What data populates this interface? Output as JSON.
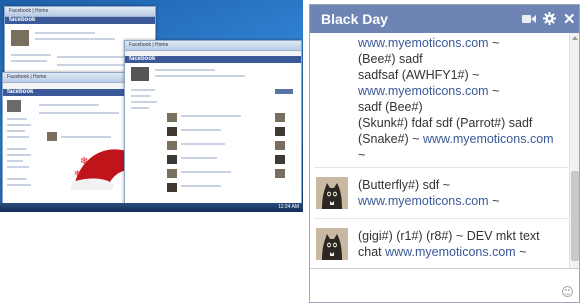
{
  "desktop": {
    "facebook_logo": "facebook",
    "windows": [
      {
        "caption": "Facebook | Home"
      },
      {
        "caption": "Facebook | Home"
      },
      {
        "caption": "Facebook | Home"
      }
    ],
    "clock": "11:24 AM"
  },
  "chat": {
    "title": "Black Day",
    "messages": [
      {
        "lines": [
          {
            "parts": [
              {
                "t": "link",
                "v": "www.myemoticons.com"
              },
              {
                "t": "text",
                "v": " ~"
              }
            ]
          },
          {
            "parts": [
              {
                "t": "text",
                "v": "(Bee#) sadf"
              }
            ]
          },
          {
            "parts": [
              {
                "t": "text",
                "v": "sadfsaf (AWHFY1#) ~"
              }
            ]
          },
          {
            "parts": [
              {
                "t": "link",
                "v": "www.myemoticons.com"
              },
              {
                "t": "text",
                "v": " ~"
              }
            ]
          },
          {
            "parts": [
              {
                "t": "text",
                "v": "sadf (Bee#)"
              }
            ]
          },
          {
            "parts": [
              {
                "t": "text",
                "v": "(Skunk#) fdaf sdf (Parrot#) sadf"
              }
            ]
          },
          {
            "parts": [
              {
                "t": "text",
                "v": "(Snake#) ~  "
              },
              {
                "t": "link",
                "v": "www.myemoticons.com"
              }
            ]
          },
          {
            "parts": [
              {
                "t": "text",
                "v": "~"
              }
            ]
          }
        ]
      },
      {
        "lines": [
          {
            "parts": [
              {
                "t": "text",
                "v": "(Butterfly#) sdf ~"
              }
            ]
          },
          {
            "parts": [
              {
                "t": "link",
                "v": "www.myemoticons.com"
              },
              {
                "t": "text",
                "v": " ~"
              }
            ]
          }
        ]
      },
      {
        "lines": [
          {
            "parts": [
              {
                "t": "text",
                "v": "(gigi#) (r1#) (r8#) ~ DEV mkt text"
              }
            ]
          },
          {
            "parts": [
              {
                "t": "text",
                "v": "chat "
              },
              {
                "t": "link",
                "v": "www.myemoticons.com"
              },
              {
                "t": "text",
                "v": " ~"
              }
            ]
          }
        ]
      }
    ],
    "input_placeholder": "",
    "icons": {
      "video": "video-icon",
      "settings": "gear-icon",
      "close": "close-icon",
      "emoticon": "emoticon-icon"
    },
    "colors": {
      "header": "#6d84b4",
      "link": "#3b5998"
    }
  }
}
